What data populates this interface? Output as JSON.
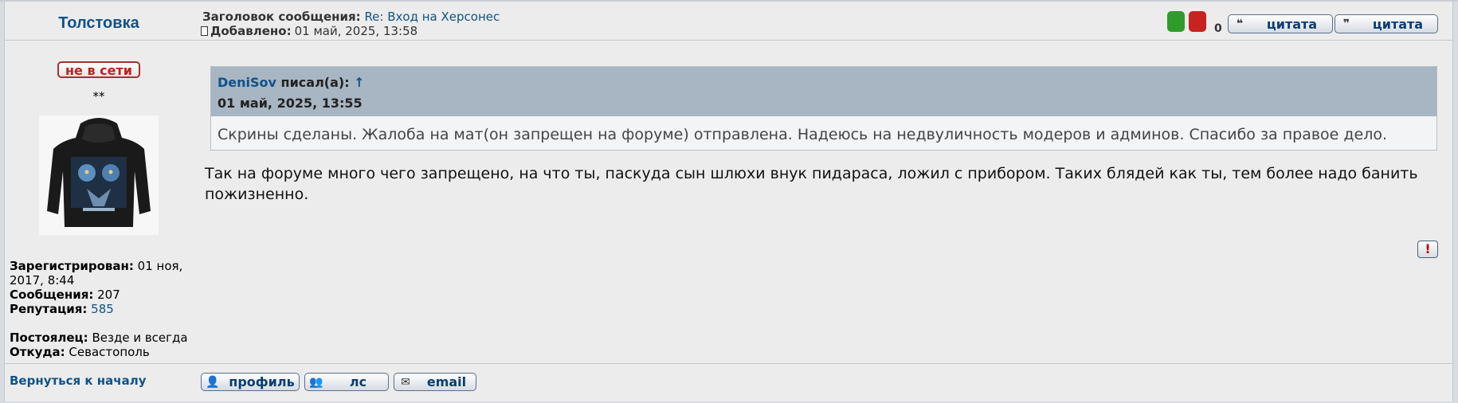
{
  "author": {
    "name": "Толстовка"
  },
  "header": {
    "subject_label": "Заголовок сообщения:",
    "subject_value": "Re: Вход на Херсонес",
    "posted_label": "Добавлено:",
    "posted_value": "01 май, 2025, 13:58",
    "vote_count": "0",
    "quote_button_1": "цитата",
    "quote_button_2": "цитата"
  },
  "profile": {
    "status": "не в сети",
    "rank": "**",
    "registered_label": "Зарегистрирован:",
    "registered_value": "01 ноя, 2017, 8:44",
    "posts_label": "Сообщения:",
    "posts_value": "207",
    "reputation_label": "Репутация:",
    "reputation_value": "585",
    "resident_label": "Постоялец:",
    "resident_value": "Везде и всегда",
    "from_label": "Откуда:",
    "from_value": "Севастополь"
  },
  "quote": {
    "user": "DeniSov",
    "wrote": "писал(а):",
    "arrow": "↑",
    "date": "01 май, 2025, 13:55",
    "text": "Скрины сделаны. Жалоба на мат(он запрещен на форуме) отправлена. Надеюсь на недвуличность модеров и админов. Спасибо за правое дело."
  },
  "post": {
    "text": "Так на форуме много чего запрещено, на что ты, паскуда сын шлюхи внук пидараса, ложил с прибором. Таких блядей как ты, тем более надо банить пожизненно."
  },
  "report": {
    "label": "!"
  },
  "footer": {
    "back_to_top": "Вернуться к началу",
    "profile_button": "профиль",
    "pm_button": "лс",
    "email_button": "email"
  }
}
